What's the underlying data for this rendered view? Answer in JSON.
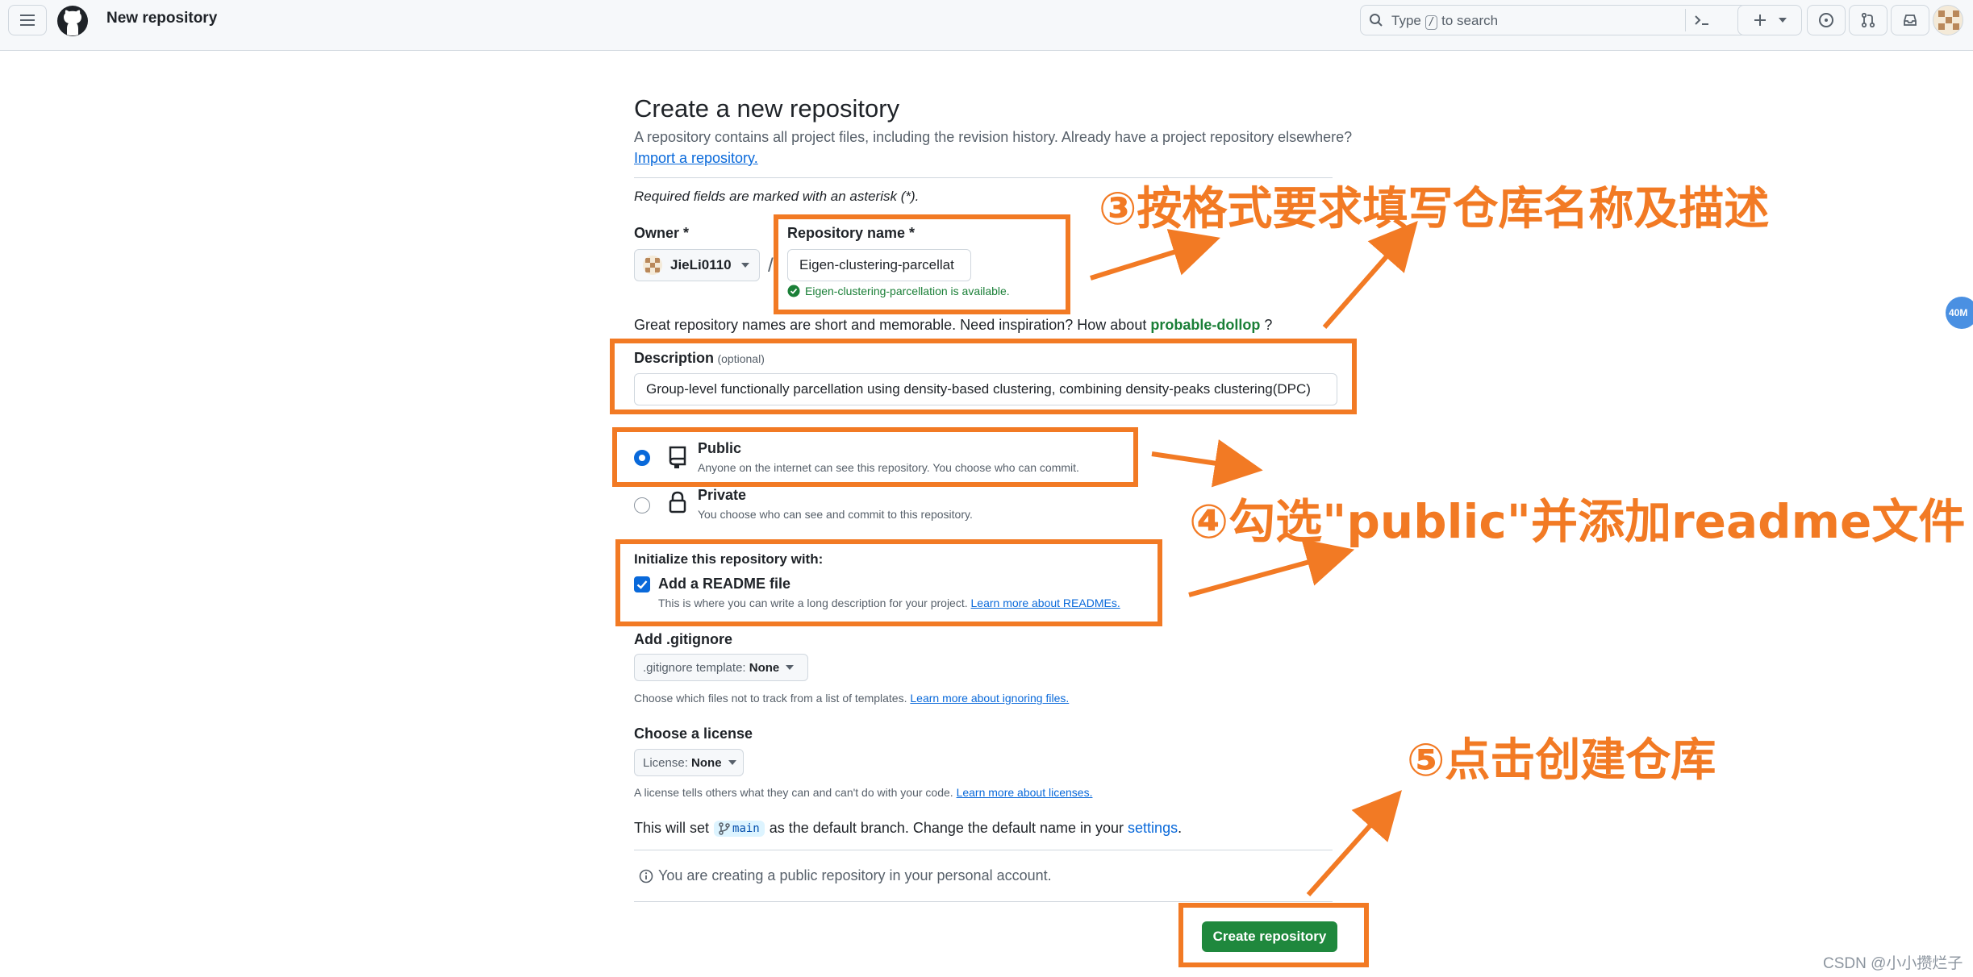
{
  "header": {
    "title": "New repository",
    "search_placeholder_prefix": "Type",
    "search_key": "/",
    "search_placeholder_suffix": "to search"
  },
  "page": {
    "heading": "Create a new repository",
    "subtitle": "A repository contains all project files, including the revision history. Already have a project repository elsewhere?",
    "import_link": "Import a repository.",
    "required_note": "Required fields are marked with an asterisk (*)."
  },
  "owner": {
    "label": "Owner *",
    "value": "JieLi0110"
  },
  "repo_name": {
    "label": "Repository name *",
    "value": "Eigen-clustering-parcellat",
    "availability": "Eigen-clustering-parcellation is available."
  },
  "inspiration": {
    "text": "Great repository names are short and memorable. Need inspiration? How about",
    "suggestion": "probable-dollop",
    "suffix": "?"
  },
  "description": {
    "label": "Description",
    "optional": "(optional)",
    "value": "Group-level functionally parcellation using density-based clustering, combining density-peaks clustering(DPC)"
  },
  "visibility": {
    "public_label": "Public",
    "public_desc": "Anyone on the internet can see this repository. You choose who can commit.",
    "private_label": "Private",
    "private_desc": "You choose who can see and commit to this repository.",
    "selected": "public"
  },
  "initialize": {
    "heading": "Initialize this repository with:",
    "readme_label": "Add a README file",
    "readme_desc": "This is where you can write a long description for your project.",
    "readme_link": "Learn more about READMEs.",
    "readme_checked": true
  },
  "gitignore": {
    "heading": "Add .gitignore",
    "select_prefix": ".gitignore template:",
    "select_value": "None",
    "desc": "Choose which files not to track from a list of templates.",
    "link": "Learn more about ignoring files."
  },
  "license": {
    "heading": "Choose a license",
    "select_prefix": "License:",
    "select_value": "None",
    "desc": "A license tells others what they can and can't do with your code.",
    "link": "Learn more about licenses."
  },
  "branch": {
    "prefix": "This will set",
    "branch_name": "main",
    "middle": "as the default branch. Change the default name in your",
    "settings_link": "settings",
    "suffix": "."
  },
  "info_note": "You are creating a public repository in your personal account.",
  "create_button": "Create repository",
  "annotations": {
    "step3": "③按格式要求填写仓库名称及描述",
    "step4": "④勾选\"public\"并添加readme文件",
    "step5": "⑤点击创建仓库"
  },
  "side_badge": "40M",
  "watermark": "CSDN @小小攒烂子",
  "colors": {
    "accent_orange": "#f27a24",
    "primary_green": "#1f883d",
    "link_blue": "#0969da",
    "success_green": "#1a7f37"
  }
}
